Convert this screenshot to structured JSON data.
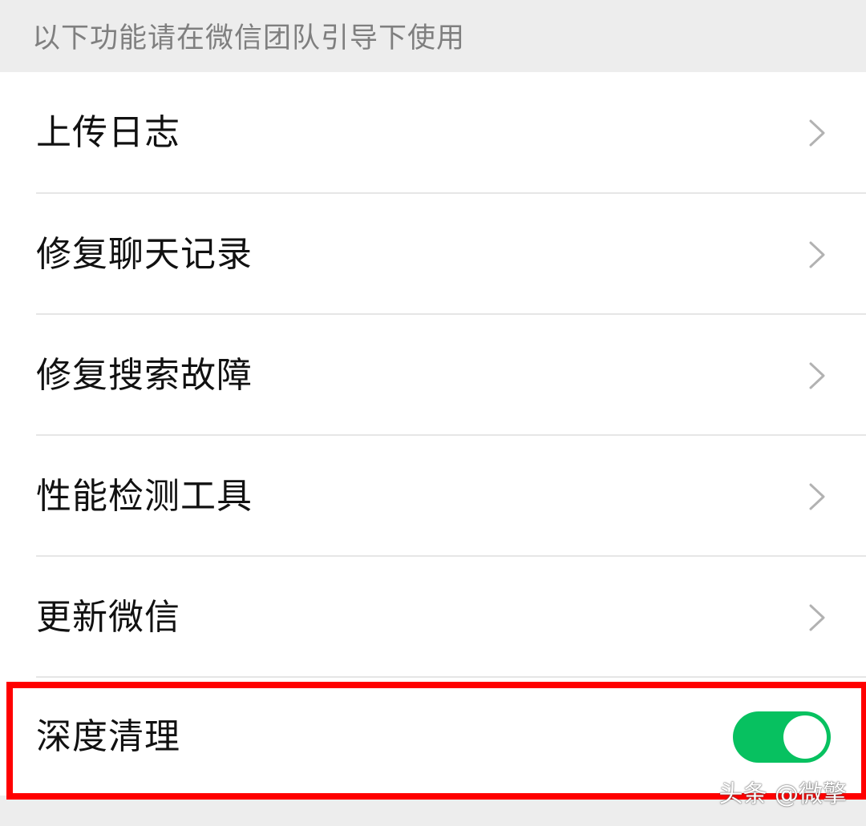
{
  "section": {
    "header": "以下功能请在微信团队引导下使用"
  },
  "menu": {
    "items": [
      {
        "label": "上传日志"
      },
      {
        "label": "修复聊天记录"
      },
      {
        "label": "修复搜索故障"
      },
      {
        "label": "性能检测工具"
      },
      {
        "label": "更新微信"
      }
    ],
    "deep_clean": {
      "label": "深度清理",
      "toggle_on": true
    }
  },
  "colors": {
    "accent": "#07c160",
    "highlight": "#ff0000"
  },
  "icons": {
    "chevron": "chevron-right-icon"
  },
  "watermark": "头条 @微擎"
}
